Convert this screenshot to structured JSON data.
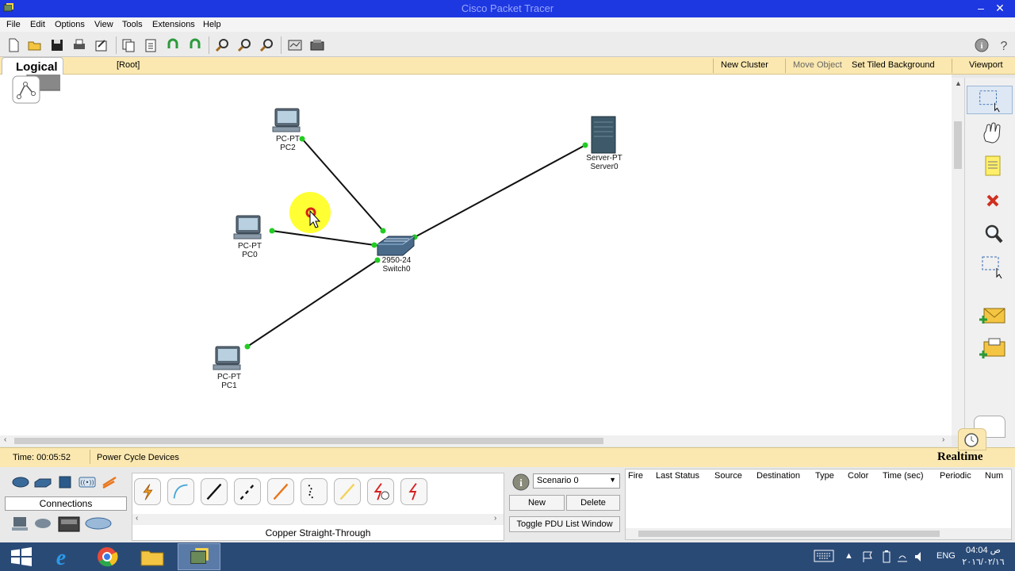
{
  "window": {
    "title": "Cisco Packet Tracer"
  },
  "menu": [
    "File",
    "Edit",
    "Options",
    "View",
    "Tools",
    "Extensions",
    "Help"
  ],
  "logical_bar": {
    "tab": "Logical",
    "root": "[Root]",
    "new_cluster": "New Cluster",
    "move_object": "Move Object",
    "set_tiled_background": "Set Tiled Background",
    "viewport": "Viewport"
  },
  "devices": {
    "pc2": {
      "type": "PC-PT",
      "name": "PC2"
    },
    "pc0": {
      "type": "PC-PT",
      "name": "PC0"
    },
    "pc1": {
      "type": "PC-PT",
      "name": "PC1"
    },
    "switch0": {
      "type": "2950-24",
      "name": "Switch0"
    },
    "server0": {
      "type": "Server-PT",
      "name": "Server0"
    }
  },
  "status": {
    "time_label": "Time: 00:05:52",
    "power_cycle": "Power Cycle Devices",
    "mode": "Realtime"
  },
  "device_panel": {
    "category": "Connections",
    "selected_connection": "Copper Straight-Through"
  },
  "pdu": {
    "scenario": "Scenario 0",
    "new_btn": "New",
    "delete_btn": "Delete",
    "toggle_btn": "Toggle PDU List Window",
    "columns": [
      "Fire",
      "Last Status",
      "Source",
      "Destination",
      "Type",
      "Color",
      "Time (sec)",
      "Periodic",
      "Num"
    ]
  },
  "taskbar": {
    "lang": "ENG",
    "time": "04:04 ص",
    "date": "٢٠١٦/٠٢/١٦"
  },
  "colors": {
    "titlebar": "#1d38e0",
    "logical_bar": "#fbe8b0",
    "link_port": "#22cc22",
    "cursor_highlight": "#ffff33"
  }
}
